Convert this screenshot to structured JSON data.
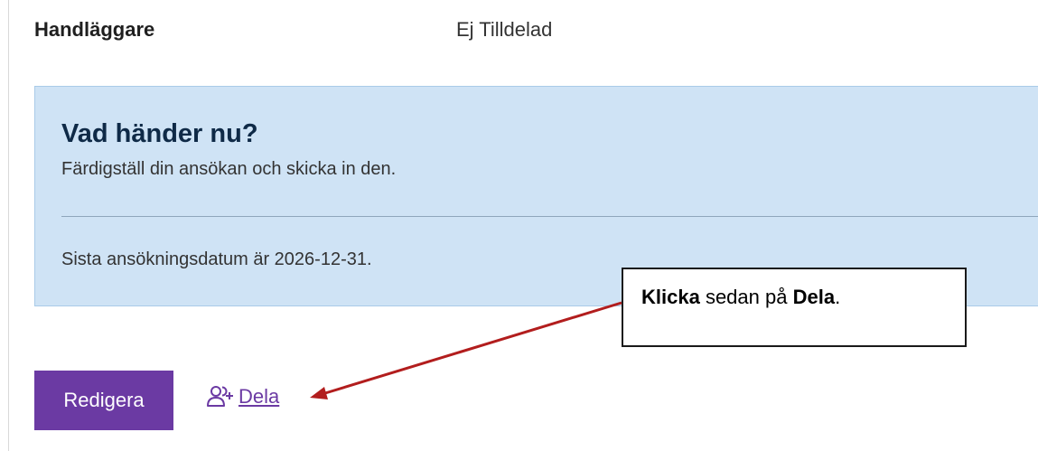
{
  "details": {
    "handler_label": "Handläggare",
    "handler_value": "Ej Tilldelad"
  },
  "info_panel": {
    "heading": "Vad händer nu?",
    "text": "Färdigställ din ansökan och skicka in den.",
    "deadline": "Sista ansökningsdatum är 2026-12-31."
  },
  "actions": {
    "edit_label": "Redigera",
    "share_label": "Dela",
    "share_icon": "add-person-icon"
  },
  "callout": {
    "part1": "Klicka",
    "part2": " sedan på ",
    "part3": "Dela",
    "part4": "."
  },
  "colors": {
    "button_purple": "#6b3aa3",
    "panel_blue": "#cfe3f5",
    "arrow_red": "#b21d1d"
  }
}
